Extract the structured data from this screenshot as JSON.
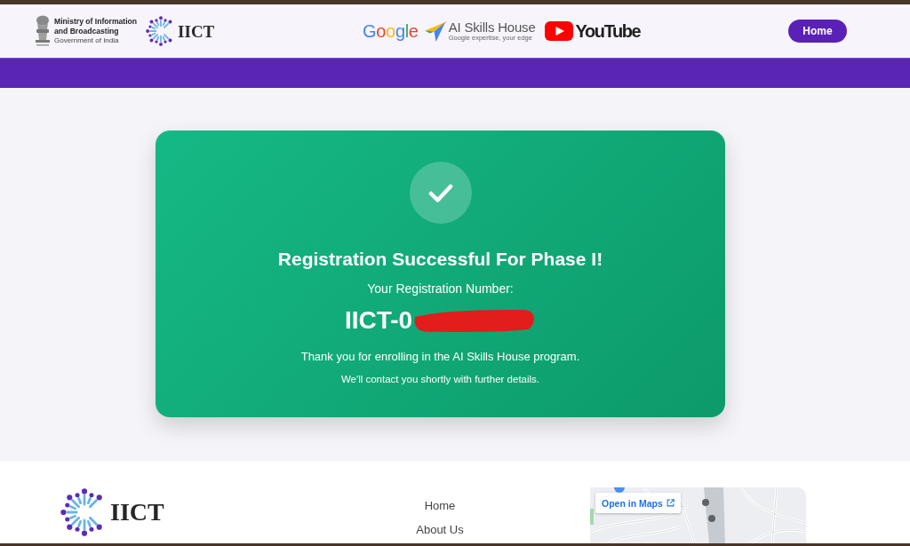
{
  "header": {
    "ministry": {
      "lines": [
        "Ministry of Information",
        "and Broadcasting"
      ],
      "subtitle": "Government of India"
    },
    "logo_text": "IICT",
    "partners": [
      {
        "kind": "google",
        "name": "Google"
      },
      {
        "kind": "ai-skills",
        "name": "AI Skills House",
        "tagline": "Google expertise, your edge"
      },
      {
        "kind": "youtube",
        "name": "YouTube"
      }
    ],
    "home_button": "Home"
  },
  "card": {
    "title": "Registration Successful For Phase I!",
    "number_label": "Your Registration Number:",
    "registration_number": "IICT-0",
    "redacted": true,
    "message": "Thank you for enrolling in the AI Skills House program.",
    "note": "We'll contact you shortly with further details."
  },
  "footer": {
    "logo_text": "IICT",
    "links": [
      "Home",
      "About Us"
    ],
    "map": {
      "open_link": "Open in Maps"
    }
  }
}
